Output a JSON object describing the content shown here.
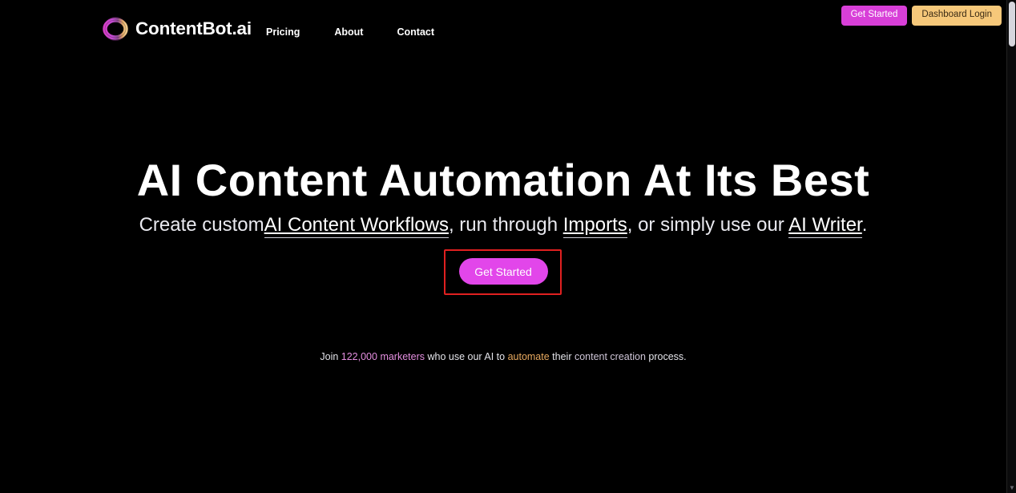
{
  "site": {
    "background_color": "#000000",
    "brand_name": "ContentBot.ai",
    "logo_icon": "contentbot-ring-logo",
    "accent_pink": "#e246ea",
    "accent_orange": "#f6c87a",
    "highlight_red": "#e02020"
  },
  "header": {
    "nav": [
      {
        "label": "Pricing"
      },
      {
        "label": "About"
      },
      {
        "label": "Contact"
      }
    ],
    "get_started_label": "Get Started",
    "dashboard_login_label": "Dashboard Login"
  },
  "hero": {
    "title": "AI Content Automation At Its Best",
    "subtitle": {
      "part1": "Create custom",
      "link1": "AI Content Workflows",
      "part2": ", run through ",
      "link2": "Imports",
      "part3": ", or simply use our ",
      "link3": "AI Writer",
      "part4": "."
    },
    "cta_label": "Get Started",
    "social_proof": {
      "part1": "Join ",
      "count": "122,000",
      "audience": " marketers",
      "part2": " who use our AI to ",
      "action": "automate",
      "part3": " their ",
      "topic": "content creation",
      "part4": " process."
    }
  },
  "scrollbar": {
    "up_arrow": "▲",
    "down_arrow": "▼"
  }
}
